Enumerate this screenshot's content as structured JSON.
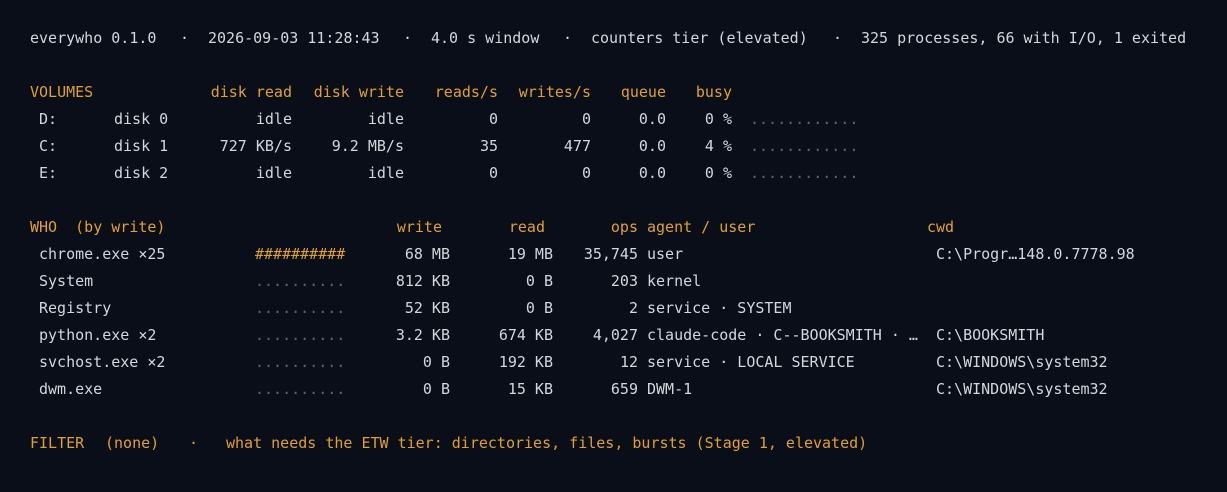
{
  "header": {
    "app": "everywho 0.1.0",
    "timestamp": "2026-09-03 11:28:43",
    "window": "4.0 s window",
    "tier": "counters tier (elevated)",
    "summary": "325 processes, 66 with I/O, 1 exited",
    "sep": "·"
  },
  "colors": {
    "background": "#0a0e18",
    "text": "#d4d6dc",
    "accent": "#e0a030",
    "dim": "#5f6573"
  },
  "volumes": {
    "headers": {
      "title": "VOLUMES",
      "disk_read": "disk read",
      "disk_write": "disk write",
      "reads_s": "reads/s",
      "writes_s": "writes/s",
      "queue": "queue",
      "busy": "busy"
    },
    "rows": [
      {
        "letter": "D:",
        "disk": "disk 0",
        "read": "idle",
        "write": "idle",
        "reads": "0",
        "writes": "0",
        "queue": "0.0",
        "busy": "0 %",
        "bar": "............"
      },
      {
        "letter": "C:",
        "disk": "disk 1",
        "read": "727 KB/s",
        "write": "9.2 MB/s",
        "reads": "35",
        "writes": "477",
        "queue": "0.0",
        "busy": "4 %",
        "bar": "............"
      },
      {
        "letter": "E:",
        "disk": "disk 2",
        "read": "idle",
        "write": "idle",
        "reads": "0",
        "writes": "0",
        "queue": "0.0",
        "busy": "0 %",
        "bar": "............"
      }
    ]
  },
  "who": {
    "headers": {
      "title": "WHO  (by write)",
      "write": "write",
      "read": "read",
      "ops": "ops",
      "agent": "agent / user",
      "cwd": "cwd"
    },
    "rows": [
      {
        "name": "chrome.exe ×25",
        "bar": "##########",
        "bar_hot": true,
        "write": "68 MB",
        "read": "19 MB",
        "ops": "35,745",
        "agent": "user",
        "cwd": "C:\\Progr…148.0.7778.98"
      },
      {
        "name": "System",
        "bar": "..........",
        "bar_hot": false,
        "write": "812 KB",
        "read": "0 B",
        "ops": "203",
        "agent": "kernel",
        "cwd": ""
      },
      {
        "name": "Registry",
        "bar": "..........",
        "bar_hot": false,
        "write": "52 KB",
        "read": "0 B",
        "ops": "2",
        "agent": "service · SYSTEM",
        "cwd": ""
      },
      {
        "name": "python.exe ×2",
        "bar": "..........",
        "bar_hot": false,
        "write": "3.2 KB",
        "read": "674 KB",
        "ops": "4,027",
        "agent": "claude-code · C--BOOKSMITH · …",
        "cwd": "C:\\BOOKSMITH"
      },
      {
        "name": "svchost.exe ×2",
        "bar": "..........",
        "bar_hot": false,
        "write": "0 B",
        "read": "192 KB",
        "ops": "12",
        "agent": "service · LOCAL SERVICE",
        "cwd": "C:\\WINDOWS\\system32"
      },
      {
        "name": "dwm.exe",
        "bar": "..........",
        "bar_hot": false,
        "write": "0 B",
        "read": "15 KB",
        "ops": "659",
        "agent": "DWM-1",
        "cwd": "C:\\WINDOWS\\system32"
      }
    ]
  },
  "footer": {
    "filter_label": "FILTER",
    "filter_value": "(none)",
    "sep": "·",
    "hint": "what needs the ETW tier: directories, files, bursts (Stage 1, elevated)"
  }
}
